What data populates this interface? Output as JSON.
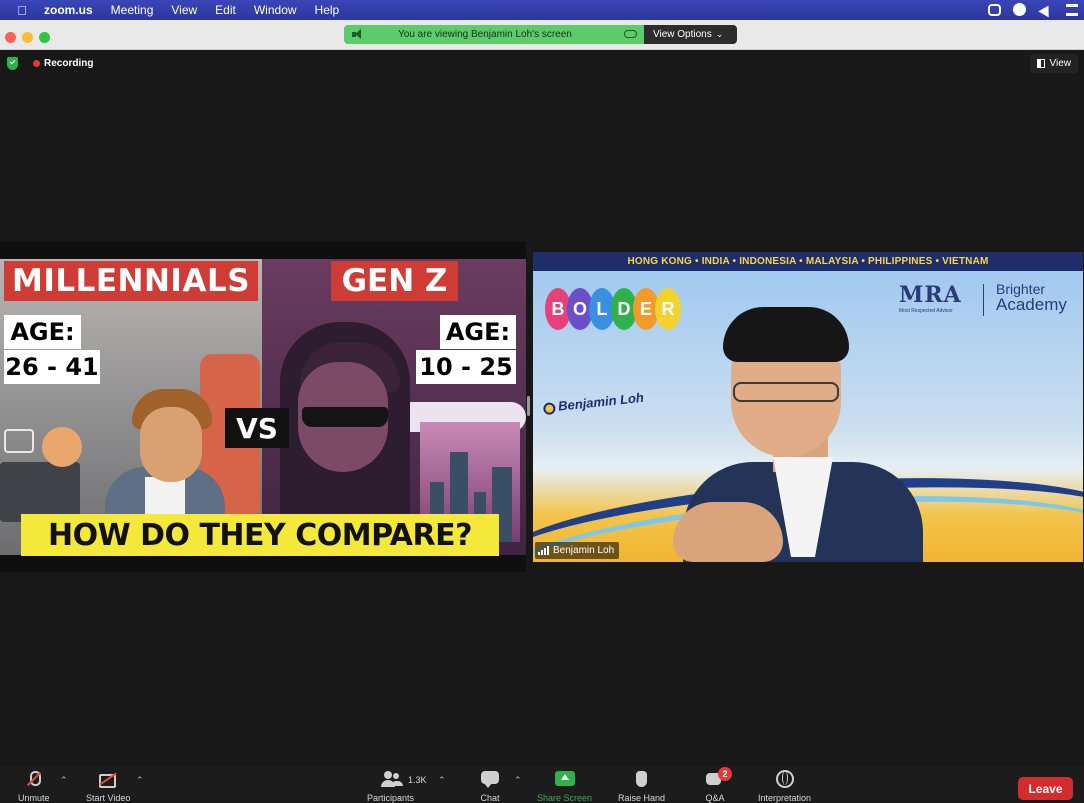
{
  "menubar": {
    "app_name": "zoom.us",
    "items": [
      "Meeting",
      "View",
      "Edit",
      "Window",
      "Help"
    ]
  },
  "banner": {
    "text": "You are viewing Benjamin Loh's screen",
    "view_options_label": "View Options",
    "color": "#5ecb6a"
  },
  "status": {
    "recording_label": "Recording",
    "view_label": "View"
  },
  "shared_screen": {
    "left_title": "MILLENNIALS",
    "right_title": "GEN Z",
    "age_label": "AGE:",
    "left_age": "26 - 41",
    "right_age": "10 - 25",
    "versus": "VS",
    "caption": "HOW DO THEY COMPARE?"
  },
  "video": {
    "countries": "HONG KONG • INDIA • INDONESIA • MALAYSIA • PHILIPPINES • VIETNAM",
    "bolder_letters": [
      "B",
      "O",
      "L",
      "D",
      "E",
      "R"
    ],
    "bolder_colors": [
      "#e8407a",
      "#6b4fc8",
      "#3a8fe0",
      "#2fb24c",
      "#f39a2a",
      "#f1d22e"
    ],
    "mra": "MRA",
    "mra_sub": "Most Respected Advisor",
    "brighter": "Brighter",
    "academy": "Academy",
    "sign_name": "Benjamin Loh",
    "participant_name": "Benjamin Loh"
  },
  "toolbar": {
    "unmute": "Unmute",
    "start_video": "Start Video",
    "participants": "Participants",
    "participants_count": "1.3K",
    "chat": "Chat",
    "share_screen": "Share Screen",
    "raise_hand": "Raise Hand",
    "qa": "Q&A",
    "qa_badge": "2",
    "interpretation": "Interpretation",
    "leave": "Leave",
    "leave_color": "#d42c2c"
  }
}
